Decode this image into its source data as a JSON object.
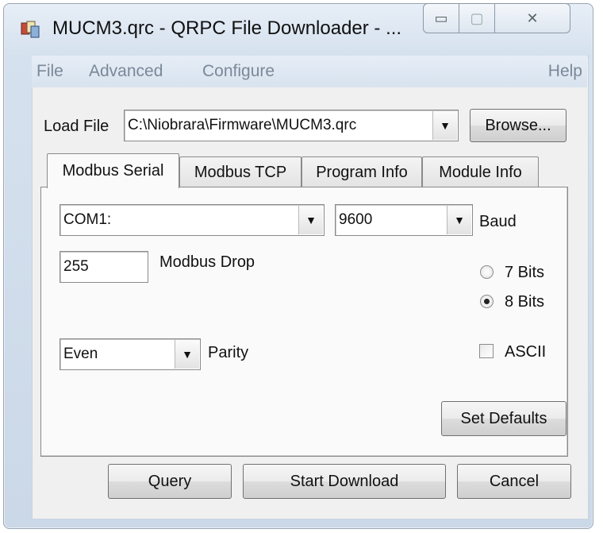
{
  "window": {
    "title": "MUCM3.qrc - QRPC File Downloader - ...",
    "minimize_glyph": "▭",
    "maximize_glyph": "▢",
    "close_glyph": "✕"
  },
  "menu": {
    "file": "File",
    "advanced": "Advanced",
    "configure": "Configure",
    "help": "Help"
  },
  "load_file": {
    "label": "Load File",
    "value": "C:\\Niobrara\\Firmware\\MUCM3.qrc",
    "browse": "Browse..."
  },
  "tabs": [
    "Modbus Serial",
    "Modbus TCP",
    "Program Info",
    "Module Info"
  ],
  "serial": {
    "port": "COM1:",
    "baud_value": "9600",
    "baud_label": "Baud",
    "drop_value": "255",
    "drop_label": "Modbus Drop",
    "bits7": "7 Bits",
    "bits8": "8 Bits",
    "selected_bits": "8 Bits",
    "parity_value": "Even",
    "parity_label": "Parity",
    "ascii_label": "ASCII",
    "ascii_checked": false,
    "set_defaults": "Set Defaults"
  },
  "actions": {
    "query": "Query",
    "start_download": "Start Download",
    "cancel": "Cancel"
  },
  "dropdown_glyph": "▼"
}
